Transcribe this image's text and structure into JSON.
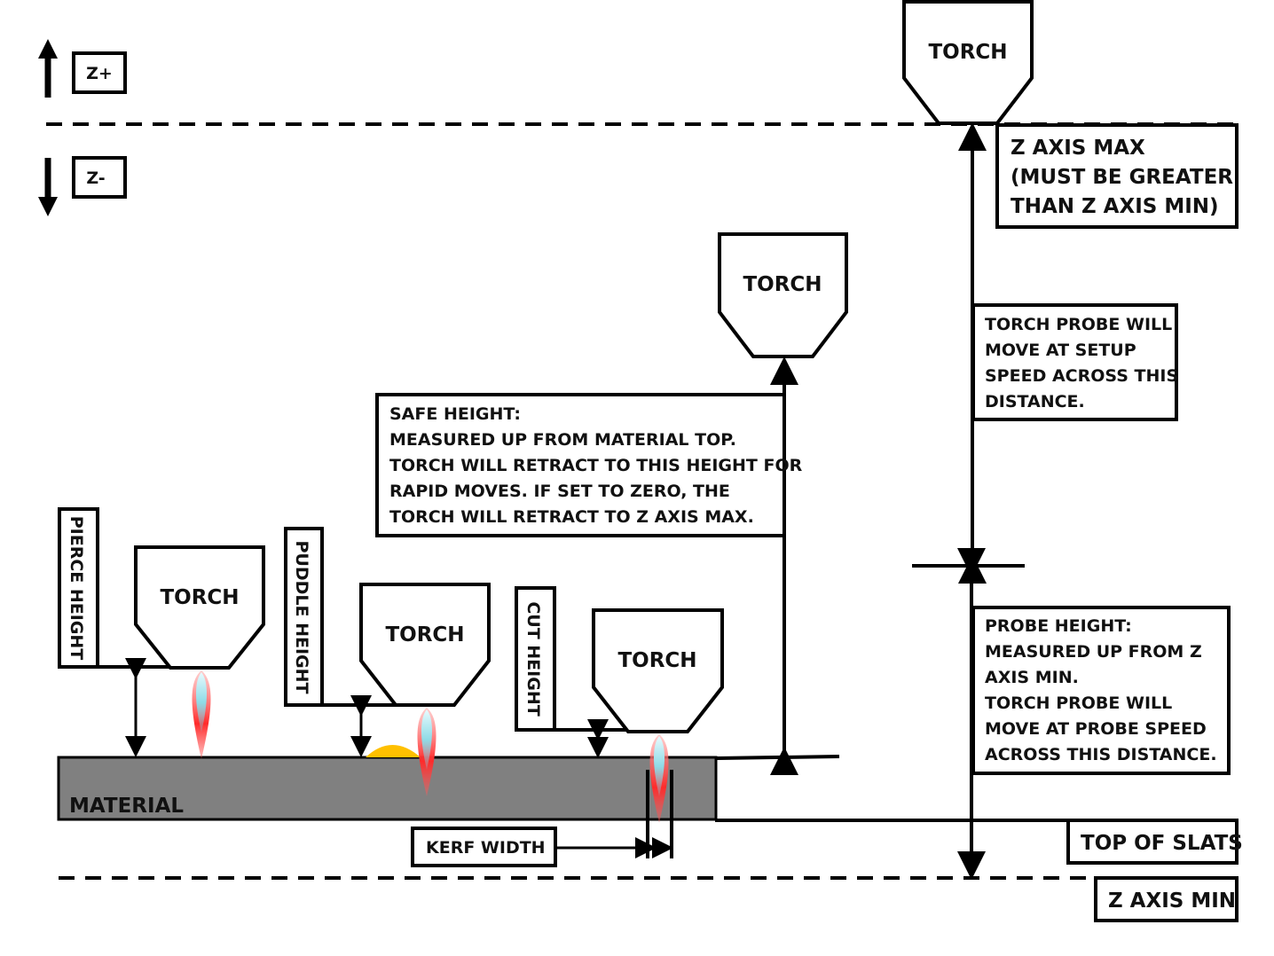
{
  "colors": {
    "material": "#808080",
    "puddle": "#FFC000",
    "flame_outer": "#FF2A2A",
    "flame_inner": "#9FE3EC",
    "ink": "#000000"
  },
  "direction": {
    "z_plus": "Z+",
    "z_minus": "Z-"
  },
  "torches": {
    "max": "TORCH",
    "safe": "TORCH",
    "pierce": "TORCH",
    "puddle": "TORCH",
    "cut": "TORCH"
  },
  "labels": {
    "z_axis_max": [
      "Z AXIS MAX",
      "(MUST BE GREATER",
      "THAN Z AXIS MIN)"
    ],
    "setup_speed": [
      "TORCH PROBE WILL",
      "MOVE AT SETUP",
      "SPEED ACROSS THIS",
      "DISTANCE."
    ],
    "safe_height": [
      "SAFE HEIGHT:",
      "MEASURED UP FROM MATERIAL TOP.",
      "TORCH WILL RETRACT TO THIS HEIGHT FOR",
      "RAPID MOVES.  IF SET TO ZERO, THE",
      "TORCH WILL RETRACT TO Z AXIS MAX."
    ],
    "probe_height": [
      "PROBE HEIGHT:",
      "MEASURED UP FROM Z",
      "AXIS MIN.",
      "TORCH PROBE WILL",
      "MOVE AT PROBE SPEED",
      "ACROSS THIS DISTANCE."
    ],
    "pierce_height": "PIERCE HEIGHT",
    "puddle_height": "PUDDLE HEIGHT",
    "cut_height": "CUT HEIGHT",
    "material": "MATERIAL",
    "kerf_width": "KERF WIDTH",
    "top_of_slats": "TOP OF SLATS",
    "z_axis_min": "Z AXIS MIN"
  }
}
